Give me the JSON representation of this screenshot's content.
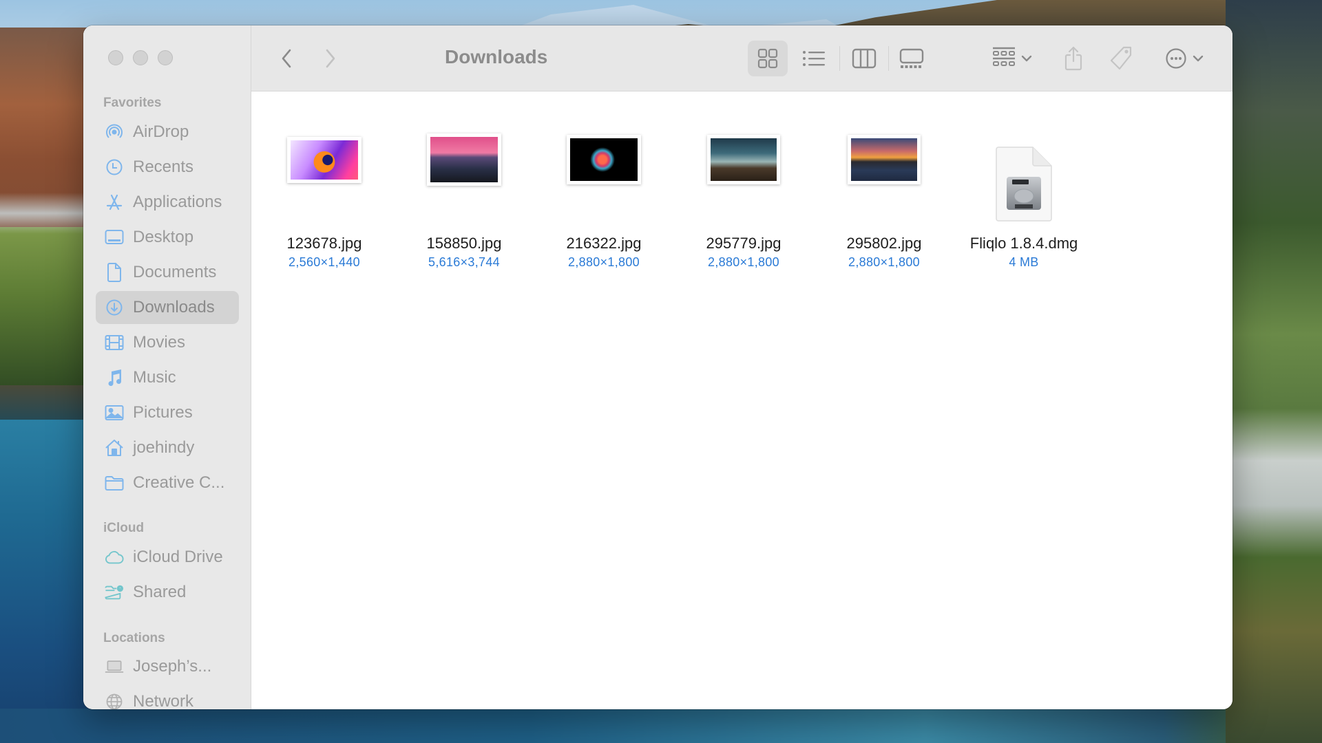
{
  "window": {
    "title": "Downloads",
    "traffic_lights": [
      "close",
      "minimize",
      "zoom"
    ]
  },
  "toolbar": {
    "back_icon": "chevron-left-icon",
    "forward_icon": "chevron-right-icon",
    "title": "Downloads",
    "view_modes": [
      {
        "name": "icon-view",
        "icon": "grid-icon",
        "selected": true
      },
      {
        "name": "list-view",
        "icon": "list-icon",
        "selected": false
      },
      {
        "name": "column-view",
        "icon": "columns-icon",
        "selected": false
      },
      {
        "name": "gallery-view",
        "icon": "gallery-icon",
        "selected": false
      }
    ],
    "actions": [
      "group-icon",
      "share-icon",
      "tag-icon",
      "more-icon",
      "search-icon"
    ]
  },
  "sidebar": {
    "sections": [
      {
        "header": "Favorites",
        "items": [
          {
            "label": "AirDrop",
            "icon": "airdrop-icon"
          },
          {
            "label": "Recents",
            "icon": "clock-icon"
          },
          {
            "label": "Applications",
            "icon": "applications-icon"
          },
          {
            "label": "Desktop",
            "icon": "desktop-icon"
          },
          {
            "label": "Documents",
            "icon": "document-icon"
          },
          {
            "label": "Downloads",
            "icon": "download-icon",
            "selected": true
          },
          {
            "label": "Movies",
            "icon": "film-icon"
          },
          {
            "label": "Music",
            "icon": "music-note-icon"
          },
          {
            "label": "Pictures",
            "icon": "photo-icon"
          },
          {
            "label": "joehindy",
            "icon": "home-icon"
          },
          {
            "label": "Creative C...",
            "icon": "folder-icon"
          }
        ]
      },
      {
        "header": "iCloud",
        "items": [
          {
            "label": "iCloud Drive",
            "icon": "cloud-icon"
          },
          {
            "label": "Shared",
            "icon": "shared-folder-icon"
          }
        ]
      },
      {
        "header": "Locations",
        "items": [
          {
            "label": "Joseph’s...",
            "icon": "laptop-icon"
          },
          {
            "label": "Network",
            "icon": "globe-icon"
          }
        ]
      }
    ]
  },
  "files": [
    {
      "name": "123678.jpg",
      "meta": "2,560×1,440",
      "kind": "image",
      "thumb": "abstract-swirl"
    },
    {
      "name": "158850.jpg",
      "meta": "5,616×3,744",
      "kind": "image",
      "thumb": "pink-mountain"
    },
    {
      "name": "216322.jpg",
      "meta": "2,880×1,800",
      "kind": "image",
      "thumb": "color-burst"
    },
    {
      "name": "295779.jpg",
      "meta": "2,880×1,800",
      "kind": "image",
      "thumb": "storm-railway"
    },
    {
      "name": "295802.jpg",
      "meta": "2,880×1,800",
      "kind": "image",
      "thumb": "sunset-pier"
    },
    {
      "name": "Fliqlo 1.8.4.dmg",
      "meta": "4 MB",
      "kind": "disk-image",
      "thumb": "dmg"
    }
  ],
  "colors": {
    "accent": "#2a7ad6",
    "sidebar_icon": "#7fb6ec",
    "icloud_icon": "#74c6cc",
    "sidebar_bg": "#e8e8e8",
    "selected_bg": "#d3d3d3"
  }
}
